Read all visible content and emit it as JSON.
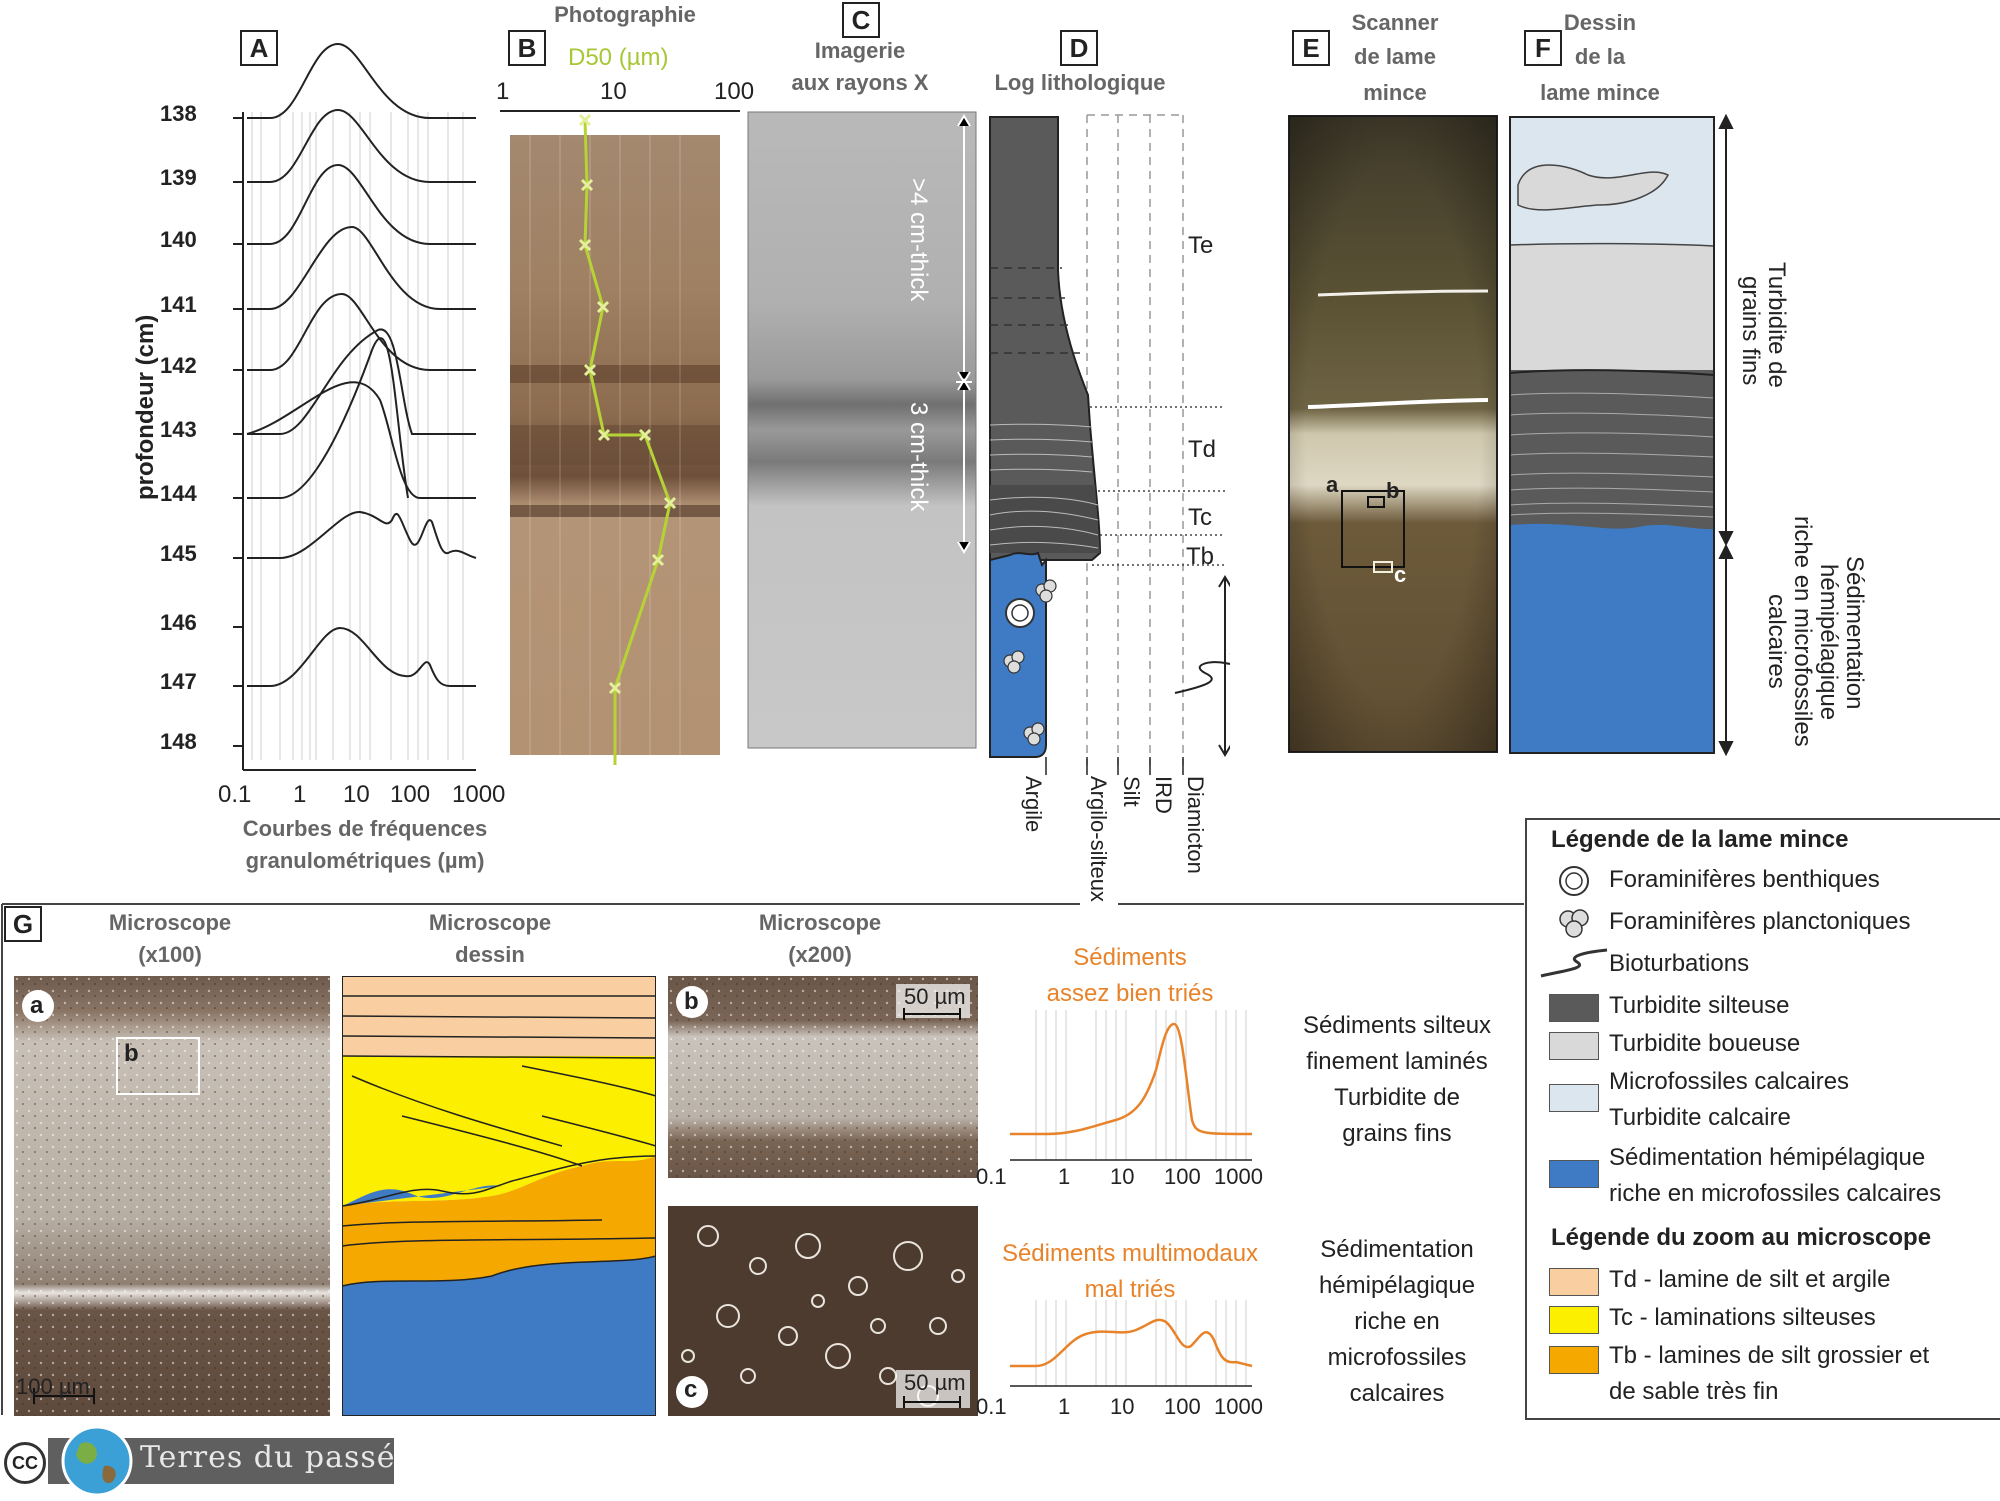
{
  "panels": {
    "A": {
      "letter": "A",
      "xlabel_line1": "Courbes de fréquences",
      "xlabel_line2": "granulométriques (µm)",
      "ylabel": "profondeur (cm)",
      "x_ticks": [
        "0.1",
        "1",
        "10",
        "100",
        "1000"
      ],
      "depth_ticks": [
        "138",
        "139",
        "140",
        "141",
        "142",
        "143",
        "144",
        "145",
        "146",
        "147",
        "148"
      ]
    },
    "B": {
      "letter": "B",
      "title": "Photographie",
      "axis_label": "D50 (µm)",
      "x_ticks": [
        "1",
        "10",
        "100"
      ]
    },
    "C": {
      "letter": "C",
      "title_line1": "Imagerie",
      "title_line2": "aux rayons X",
      "thick1": ">4 cm-thick",
      "thick2": "3 cm-thick"
    },
    "D": {
      "letter": "D",
      "title": "Log lithologique",
      "units": [
        "Te",
        "Td",
        "Tc",
        "Tb"
      ],
      "grain_classes": [
        "Argile",
        "Argilo-silteux",
        "Silt",
        "IRD",
        "Diamicton"
      ]
    },
    "E": {
      "letter": "E",
      "title_line1": "Scanner",
      "title_line2": "de lame",
      "title_line3": "mince",
      "marks": [
        "a",
        "b",
        "c"
      ]
    },
    "F": {
      "letter": "F",
      "title_line1": "Dessin",
      "title_line2": "de la",
      "title_line3": "lame mince",
      "side_top_line1": "Turbidite de",
      "side_top_line2": "grains fins",
      "side_bottom_line1": "Sédimentation",
      "side_bottom_line2": "hémipélagique",
      "side_bottom_line3": "riche en microfossiles",
      "side_bottom_line4": "calcaires"
    },
    "G": {
      "letter": "G",
      "col1_line1": "Microscope",
      "col1_line2": "(x100)",
      "col2_line1": "Microscope",
      "col2_line2": "dessin",
      "col3_line1": "Microscope",
      "col3_line2": "(x200)",
      "scale_a": "100 µm",
      "scale_b": "50 µm",
      "scale_c": "50 µm",
      "tag_a": "a",
      "tag_b": "b",
      "tag_c": "c",
      "curve1_line1": "Sédiments",
      "curve1_line2": "assez bien triés",
      "curve2_line1": "Sédiments multimodaux",
      "curve2_line2": "mal triés",
      "x_ticks": [
        "0.1",
        "1",
        "10",
        "100",
        "1000"
      ],
      "note1": [
        "Sédiments silteux",
        "finement laminés",
        "Turbidite de",
        "grains fins"
      ],
      "note2": [
        "Sédimentation",
        "hémipélagique",
        "riche en",
        "microfossiles",
        "calcaires"
      ]
    }
  },
  "legend": {
    "title1": "Légende de la lame mince",
    "items1": [
      "Foraminifères benthiques",
      "Foraminifères planctoniques",
      "Bioturbations",
      "Turbidite silteuse",
      "Turbidite boueuse",
      "Microfossiles calcaires",
      "Turbidite calcaire",
      "Sédimentation hémipélagique",
      "riche en microfossiles calcaires"
    ],
    "title2": "Légende du zoom au microscope",
    "items2": [
      "Td - lamine de silt et argile",
      "Tc - laminations silteuses",
      "Tb - lamines de silt grossier et",
      "de sable très fin"
    ]
  },
  "colors": {
    "silt_turbidite": "#5a5a5a",
    "mud_turbidite": "#d9d9d9",
    "calc_turbidite": "#dbe6ef",
    "hemipelagic": "#3f7bc4",
    "Td": "#f9cfa2",
    "Tc": "#fcef00",
    "Tb": "#f5a800",
    "orange": "#e8832a",
    "d50_line": "#b5d334"
  },
  "footer": {
    "cc": "CC",
    "brand": "Terres du passé"
  }
}
